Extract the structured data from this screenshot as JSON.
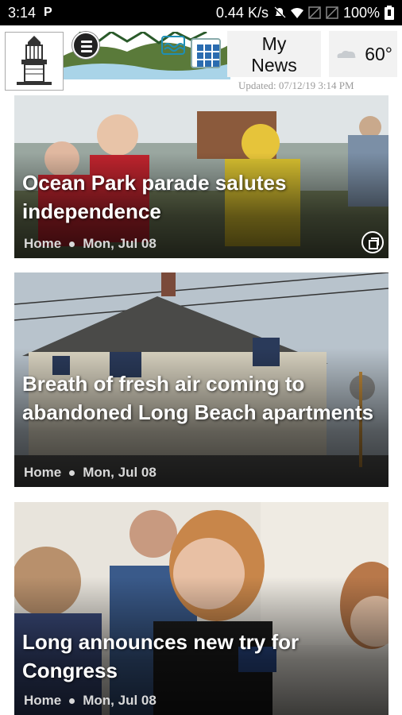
{
  "status_bar": {
    "time": "3:14",
    "carrier_icon": "P",
    "network_speed": "0.44 K/s",
    "battery": "100%"
  },
  "header": {
    "my_news_line1": "My",
    "my_news_line2": "News",
    "temperature": "60°",
    "updated": "Updated: 07/12/19 3:14 PM"
  },
  "articles": [
    {
      "headline": "Ocean Park parade salutes independence",
      "section": "Home",
      "date": "Mon, Jul 08",
      "has_gallery": true
    },
    {
      "headline": "Breath of fresh air coming to abandoned Long Beach apartments",
      "section": "Home",
      "date": "Mon, Jul 08",
      "has_gallery": false
    },
    {
      "headline": "Long announces new try for Congress",
      "section": "Home",
      "date": "Mon, Jul 08",
      "has_gallery": false
    }
  ],
  "colors": {
    "status_bar_bg": "#000000",
    "grid_icon": "#2b6cb0",
    "updated_text": "#9a9a9a"
  }
}
